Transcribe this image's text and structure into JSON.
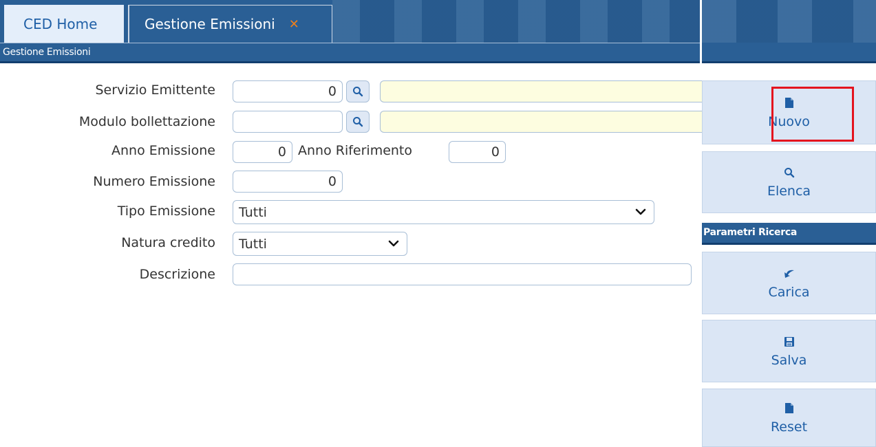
{
  "tabs": {
    "home": "CED Home",
    "active": "Gestione Emissioni",
    "close_icon": "close-icon"
  },
  "breadcrumb": "Gestione Emissioni",
  "form": {
    "servizio_emittente": {
      "label": "Servizio Emittente",
      "value": "0",
      "description": ""
    },
    "modulo_bollettazione": {
      "label": "Modulo bollettazione",
      "value": "",
      "description": ""
    },
    "anno_emissione": {
      "label": "Anno Emissione",
      "value": "0"
    },
    "anno_riferimento": {
      "label": "Anno Riferimento",
      "value": "0"
    },
    "numero_emissione": {
      "label": "Numero Emissione",
      "value": "0"
    },
    "tipo_emissione": {
      "label": "Tipo Emissione",
      "selected": "Tutti"
    },
    "natura_credito": {
      "label": "Natura credito",
      "selected": "Tutti"
    },
    "descrizione": {
      "label": "Descrizione",
      "value": ""
    }
  },
  "actions": {
    "nuovo": "Nuovo",
    "elenca": "Elenca",
    "section_title": "Parametri Ricerca",
    "carica": "Carica",
    "salva": "Salva",
    "reset": "Reset"
  },
  "colors": {
    "header_blue": "#2a5f95",
    "button_bg": "#dbe6f5",
    "link_blue": "#1f5fa6",
    "highlight": "#e4141e",
    "lookup_yellow": "#fdfde0"
  }
}
